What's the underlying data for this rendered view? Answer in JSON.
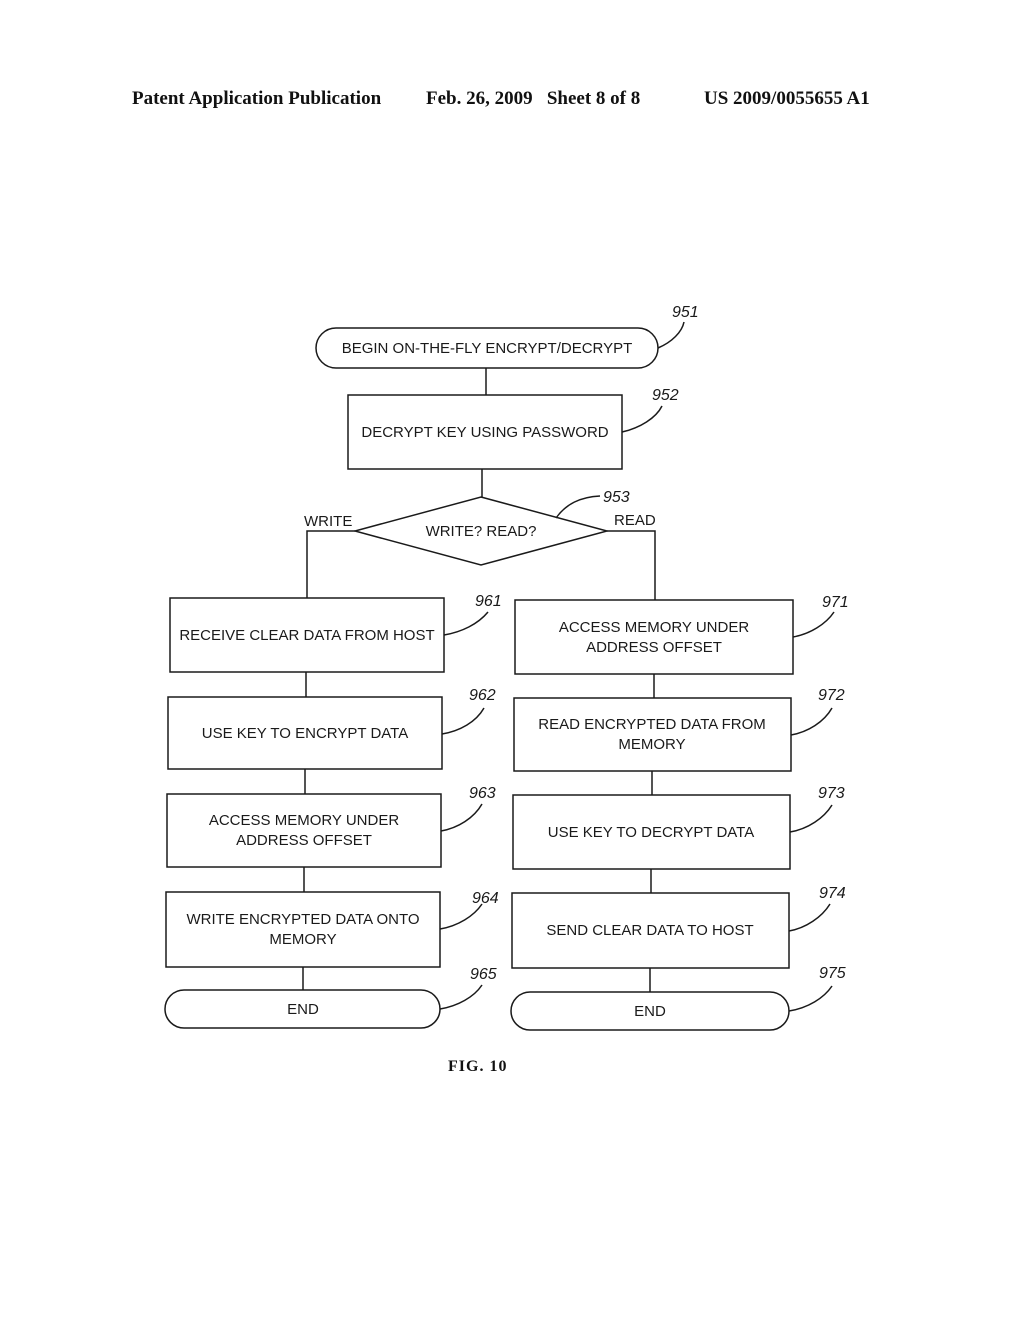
{
  "header": {
    "publication": "Patent Application Publication",
    "date_sheet": "Feb. 26, 2009   Sheet 8 of 8",
    "patent_number": "US 2009/0055655 A1"
  },
  "figure_label": "FIG. 10",
  "flowchart": {
    "start": {
      "ref": "951",
      "label": "BEGIN ON-THE-FLY ENCRYPT/DECRYPT"
    },
    "decrypt_key": {
      "ref": "952",
      "label": "DECRYPT KEY USING PASSWORD"
    },
    "decision": {
      "ref": "953",
      "label": "WRITE? READ?",
      "left_branch": "WRITE",
      "right_branch": "READ"
    },
    "write_path": [
      {
        "ref": "961",
        "lines": [
          "RECEIVE CLEAR DATA FROM HOST"
        ]
      },
      {
        "ref": "962",
        "lines": [
          "USE KEY TO ENCRYPT DATA"
        ]
      },
      {
        "ref": "963",
        "lines": [
          "ACCESS MEMORY UNDER",
          "ADDRESS OFFSET"
        ]
      },
      {
        "ref": "964",
        "lines": [
          "WRITE ENCRYPTED DATA ONTO",
          "MEMORY"
        ]
      },
      {
        "ref": "965",
        "lines": [
          "END"
        ]
      }
    ],
    "read_path": [
      {
        "ref": "971",
        "lines": [
          "ACCESS MEMORY UNDER",
          "ADDRESS OFFSET"
        ]
      },
      {
        "ref": "972",
        "lines": [
          "READ ENCRYPTED DATA FROM",
          "MEMORY"
        ]
      },
      {
        "ref": "973",
        "lines": [
          "USE KEY TO DECRYPT DATA"
        ]
      },
      {
        "ref": "974",
        "lines": [
          "SEND CLEAR DATA TO HOST"
        ]
      },
      {
        "ref": "975",
        "lines": [
          "END"
        ]
      }
    ]
  }
}
